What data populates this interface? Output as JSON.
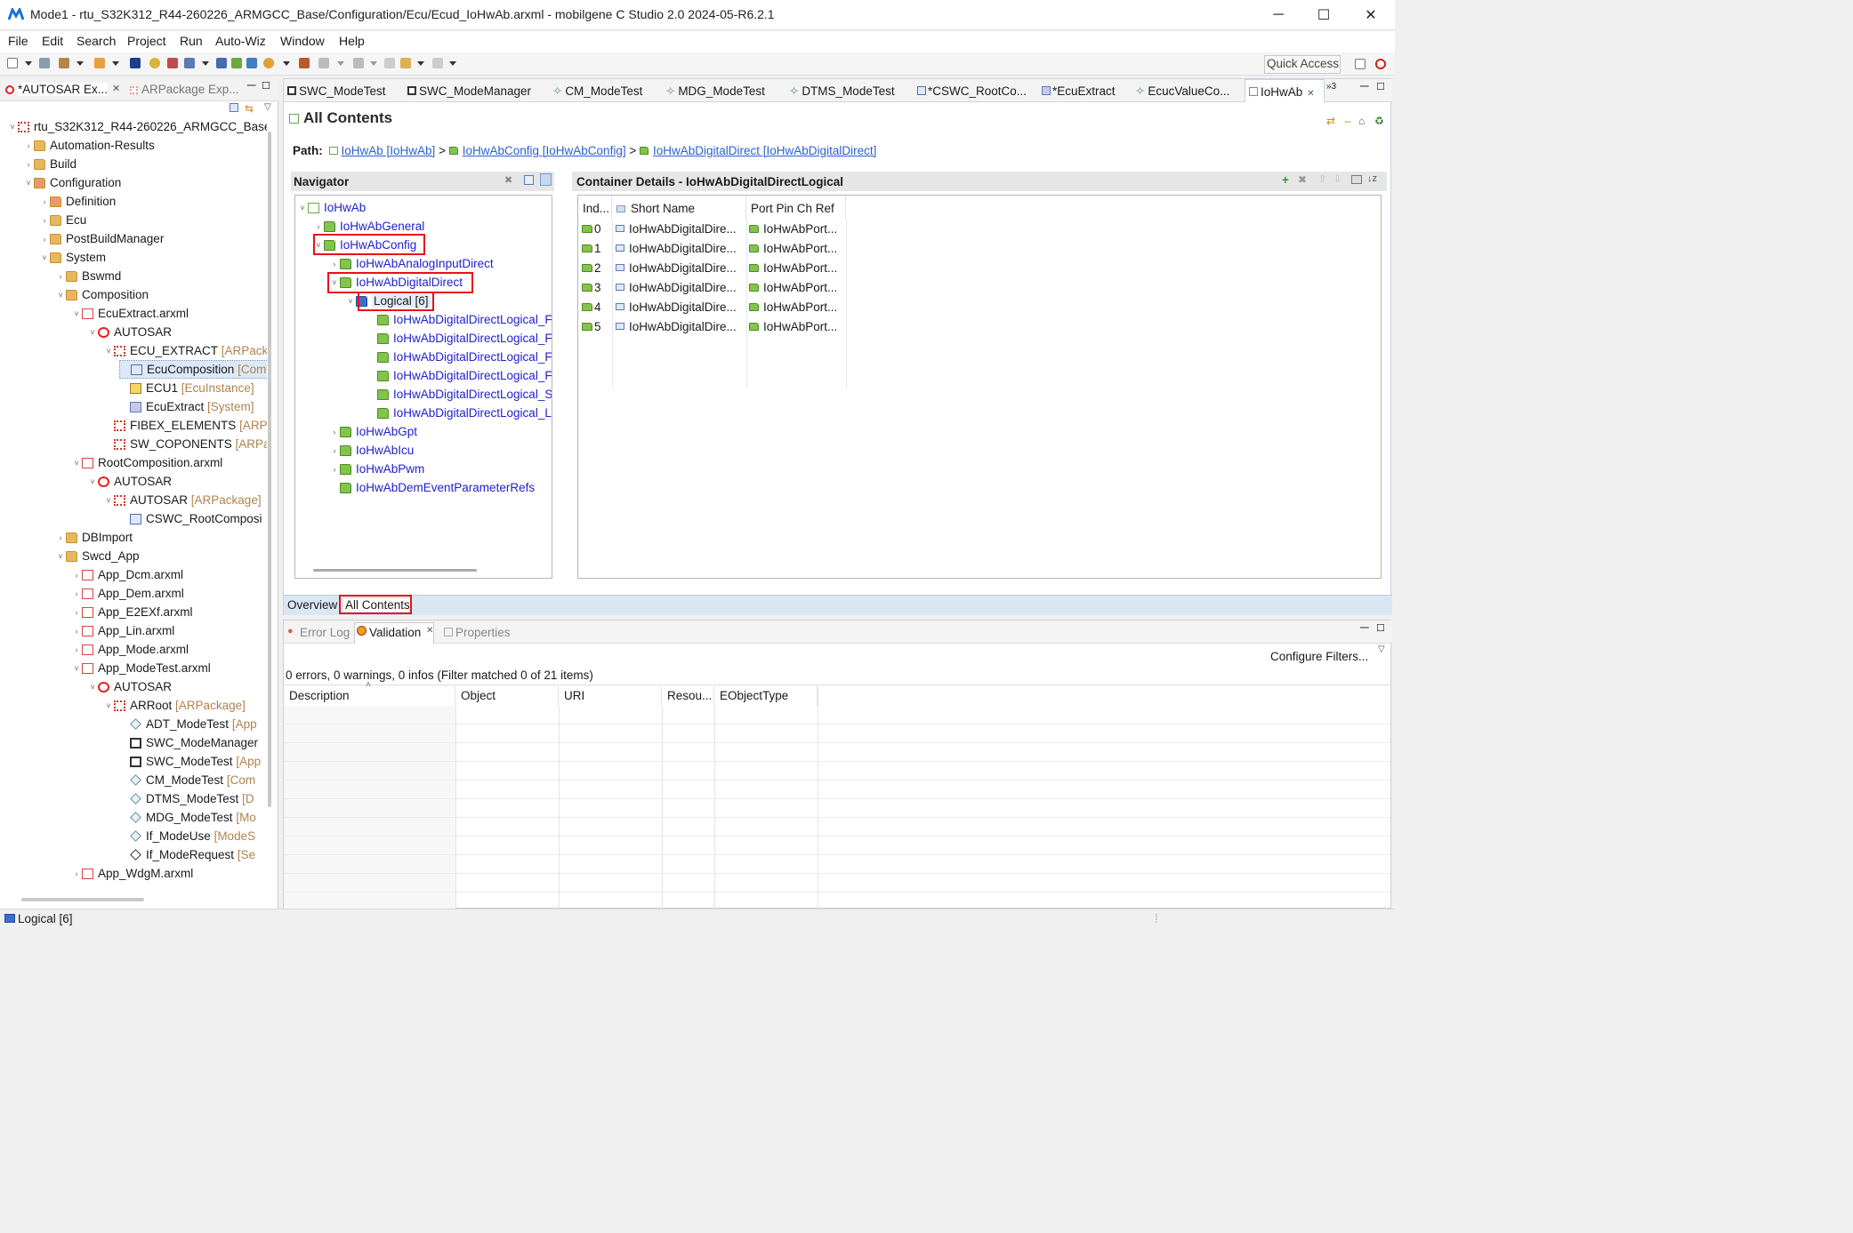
{
  "window": {
    "title": "Mode1 - rtu_S32K312_R44-260226_ARMGCC_Base/Configuration/Ecu/Ecud_IoHwAb.arxml - mobilgene C Studio 2.0 2024-05-R6.2.1",
    "minimize": "─",
    "maximize": "☐",
    "close": "✕"
  },
  "menu": [
    "File",
    "Edit",
    "Search",
    "Project",
    "Run",
    "Auto-Wiz",
    "Window",
    "Help"
  ],
  "toolbar": {
    "quick_access": "Quick Access"
  },
  "left": {
    "tabs": [
      "*AUTOSAR Ex...",
      "ARPackage Exp..."
    ],
    "tree": [
      {
        "label": "rtu_S32K312_R44-260226_ARMGCC_Base",
        "type": ""
      },
      {
        "label": "Automation-Results",
        "type": ""
      },
      {
        "label": "Build",
        "type": ""
      },
      {
        "label": "Configuration",
        "type": ""
      },
      {
        "label": "Definition",
        "type": ""
      },
      {
        "label": "Ecu",
        "type": ""
      },
      {
        "label": "PostBuildManager",
        "type": ""
      },
      {
        "label": "System",
        "type": ""
      },
      {
        "label": "Bswmd",
        "type": ""
      },
      {
        "label": "Composition",
        "type": ""
      },
      {
        "label": "EcuExtract.arxml",
        "type": ""
      },
      {
        "label": "AUTOSAR",
        "type": ""
      },
      {
        "label": "ECU_EXTRACT",
        "type": "[ARPackage]"
      },
      {
        "label": "EcuComposition",
        "type": "[Com"
      },
      {
        "label": "ECU1",
        "type": "[EcuInstance]"
      },
      {
        "label": "EcuExtract",
        "type": "[System]"
      },
      {
        "label": "FIBEX_ELEMENTS",
        "type": "[ARPa"
      },
      {
        "label": "SW_COPONENTS",
        "type": "[ARPa"
      },
      {
        "label": "RootComposition.arxml",
        "type": ""
      },
      {
        "label": "AUTOSAR",
        "type": ""
      },
      {
        "label": "AUTOSAR",
        "type": "[ARPackage]"
      },
      {
        "label": "CSWC_RootComposi",
        "type": ""
      },
      {
        "label": "DBImport",
        "type": ""
      },
      {
        "label": "Swcd_App",
        "type": ""
      },
      {
        "label": "App_Dcm.arxml",
        "type": ""
      },
      {
        "label": "App_Dem.arxml",
        "type": ""
      },
      {
        "label": "App_E2EXf.arxml",
        "type": ""
      },
      {
        "label": "App_Lin.arxml",
        "type": ""
      },
      {
        "label": "App_Mode.arxml",
        "type": ""
      },
      {
        "label": "App_ModeTest.arxml",
        "type": ""
      },
      {
        "label": "AUTOSAR",
        "type": ""
      },
      {
        "label": "ARRoot",
        "type": "[ARPackage]"
      },
      {
        "label": "ADT_ModeTest",
        "type": "[App"
      },
      {
        "label": "SWC_ModeManager",
        "type": ""
      },
      {
        "label": "SWC_ModeTest",
        "type": "[App"
      },
      {
        "label": "CM_ModeTest",
        "type": "[Com"
      },
      {
        "label": "DTMS_ModeTest",
        "type": "[D"
      },
      {
        "label": "MDG_ModeTest",
        "type": "[Mo"
      },
      {
        "label": "If_ModeUse",
        "type": "[ModeS"
      },
      {
        "label": "If_ModeRequest",
        "type": "[Se"
      },
      {
        "label": "App_WdgM.arxml",
        "type": ""
      }
    ]
  },
  "editor": {
    "tabs": [
      "SWC_ModeTest",
      "SWC_ModeManager",
      "CM_ModeTest",
      "MDG_ModeTest",
      "DTMS_ModeTest",
      "*CSWC_RootCo...",
      "*EcuExtract",
      "EcucValueCo...",
      "IoHwAb"
    ],
    "tab_overflow": "»3",
    "page_title": "All Contents",
    "path": {
      "label": "Path:",
      "items": [
        "IoHwAb [IoHwAb]",
        "IoHwAbConfig [IoHwAbConfig]",
        "IoHwAbDigitalDirect [IoHwAbDigitalDirect]"
      ],
      "separator": ">"
    },
    "navigator": {
      "title": "Navigator",
      "tree": [
        "IoHwAb",
        "IoHwAbGeneral",
        "IoHwAbConfig",
        "IoHwAbAnalogInputDirect",
        "IoHwAbDigitalDirect",
        "Logical [6]",
        "IoHwAbDigitalDirectLogical_F",
        "IoHwAbDigitalDirectLogical_F",
        "IoHwAbDigitalDirectLogical_F",
        "IoHwAbDigitalDirectLogical_F",
        "IoHwAbDigitalDirectLogical_S",
        "IoHwAbDigitalDirectLogical_L",
        "IoHwAbGpt",
        "IoHwAbIcu",
        "IoHwAbPwm",
        "IoHwAbDemEventParameterRefs"
      ]
    },
    "details": {
      "title": "Container Details - IoHwAbDigitalDirectLogical",
      "columns": [
        "Ind...",
        "Short Name",
        "Port Pin Ch Ref"
      ],
      "rows": [
        {
          "index": "0",
          "short_name": "IoHwAbDigitalDire...",
          "ref": "IoHwAbPort..."
        },
        {
          "index": "1",
          "short_name": "IoHwAbDigitalDire...",
          "ref": "IoHwAbPort..."
        },
        {
          "index": "2",
          "short_name": "IoHwAbDigitalDire...",
          "ref": "IoHwAbPort..."
        },
        {
          "index": "3",
          "short_name": "IoHwAbDigitalDire...",
          "ref": "IoHwAbPort..."
        },
        {
          "index": "4",
          "short_name": "IoHwAbDigitalDire...",
          "ref": "IoHwAbPort..."
        },
        {
          "index": "5",
          "short_name": "IoHwAbDigitalDire...",
          "ref": "IoHwAbPort..."
        }
      ]
    },
    "bottom_tabs": [
      "Overview",
      "All Contents"
    ]
  },
  "lower": {
    "tabs": [
      "Error Log",
      "Validation",
      "Properties"
    ],
    "configure_filters": "Configure Filters...",
    "summary": "0 errors, 0 warnings, 0 infos (Filter matched 0 of 21 items)",
    "columns": [
      "Description",
      "Object",
      "URI",
      "Resou...",
      "EObjectType"
    ]
  },
  "status": {
    "text": "Logical [6]"
  },
  "colors": {
    "highlight": "#e8101d",
    "link": "#2a5fd7",
    "tree_link": "#2020cc",
    "type_text": "#b0834b"
  }
}
